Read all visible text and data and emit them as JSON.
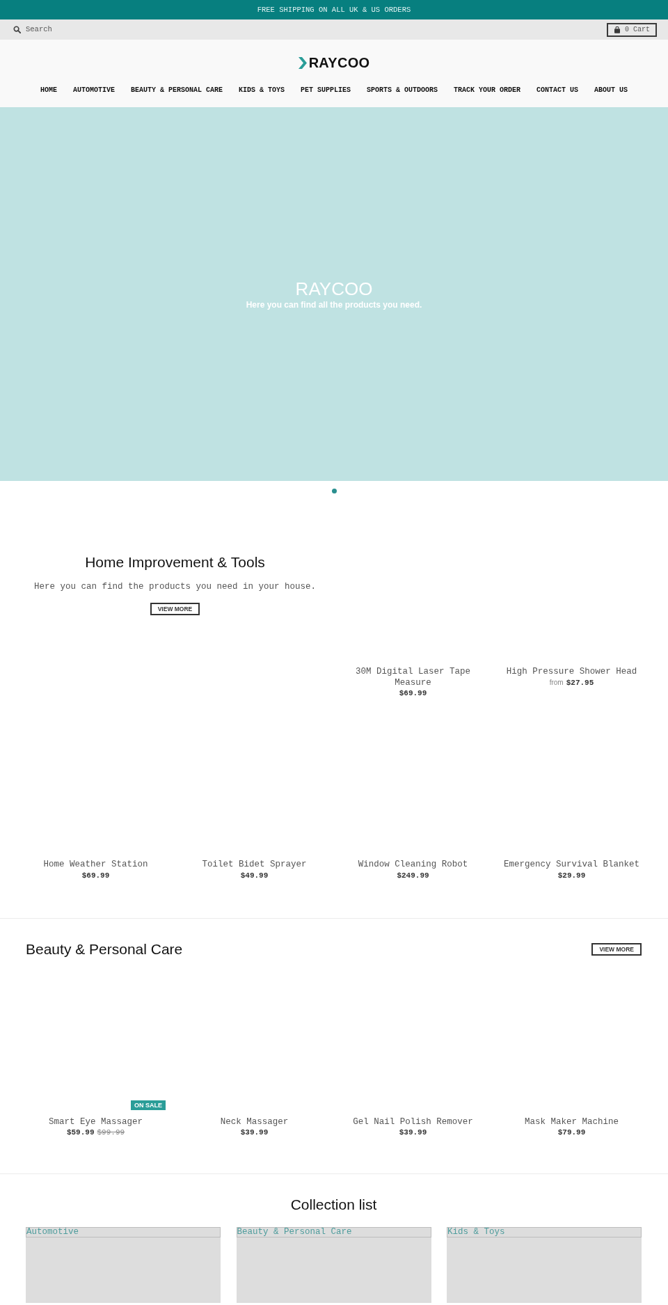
{
  "announcement": {
    "text": "FREE SHIPPING ON ALL UK & US ORDERS"
  },
  "utility_bar": {
    "search": {
      "placeholder": "Search"
    },
    "cart_button": "0 Cart"
  },
  "header": {
    "logo": "RAYCOO",
    "nav": [
      {
        "label": "HOME"
      },
      {
        "label": "AUTOMOTIVE"
      },
      {
        "label": "BEAUTY & PERSONAL CARE"
      },
      {
        "label": "KIDS & TOYS"
      },
      {
        "label": "PET SUPPLIES"
      },
      {
        "label": "SPORTS & OUTDOORS"
      },
      {
        "label": "TRACK YOUR ORDER"
      },
      {
        "label": "CONTACT US"
      },
      {
        "label": "ABOUT US"
      }
    ]
  },
  "hero": {
    "title": "RAYCOO",
    "subtitle": "Here you can find all the products you need.",
    "slide_dots": [
      {
        "selected": true
      }
    ]
  },
  "featured_collection": {
    "title": "Home Improvement & Tools",
    "description": "Here you can find the products you need in your house.",
    "button": "VIEW MORE",
    "products": [
      {
        "title": "30M Digital Laser Tape Measure",
        "price": "$69.99"
      },
      {
        "title": "High Pressure Shower Head",
        "price_prefix": "from",
        "price": "$27.95"
      },
      {
        "title": "Home Weather Station",
        "price": "$69.99"
      },
      {
        "title": "Toilet Bidet Sprayer",
        "price": "$49.99"
      },
      {
        "title": "Window Cleaning Robot",
        "price": "$249.99"
      },
      {
        "title": "Emergency Survival Blanket",
        "price": "$29.99"
      }
    ]
  },
  "beauty_collection": {
    "title": "Beauty & Personal Care",
    "button": "VIEW MORE",
    "products": [
      {
        "title": "Smart Eye Massager",
        "badge": "ON SALE",
        "price": "$59.99",
        "compare_at_price": "$99.99"
      },
      {
        "title": "Neck Massager",
        "price": "$39.99"
      },
      {
        "title": "Gel Nail Polish Remover",
        "price": "$39.99"
      },
      {
        "title": "Mask Maker Machine",
        "price": "$79.99"
      }
    ]
  },
  "collection_list": {
    "title": "Collection list",
    "collections": [
      {
        "label": "Automotive"
      },
      {
        "label": "Beauty & Personal Care"
      },
      {
        "label": "Kids & Toys"
      }
    ]
  }
}
